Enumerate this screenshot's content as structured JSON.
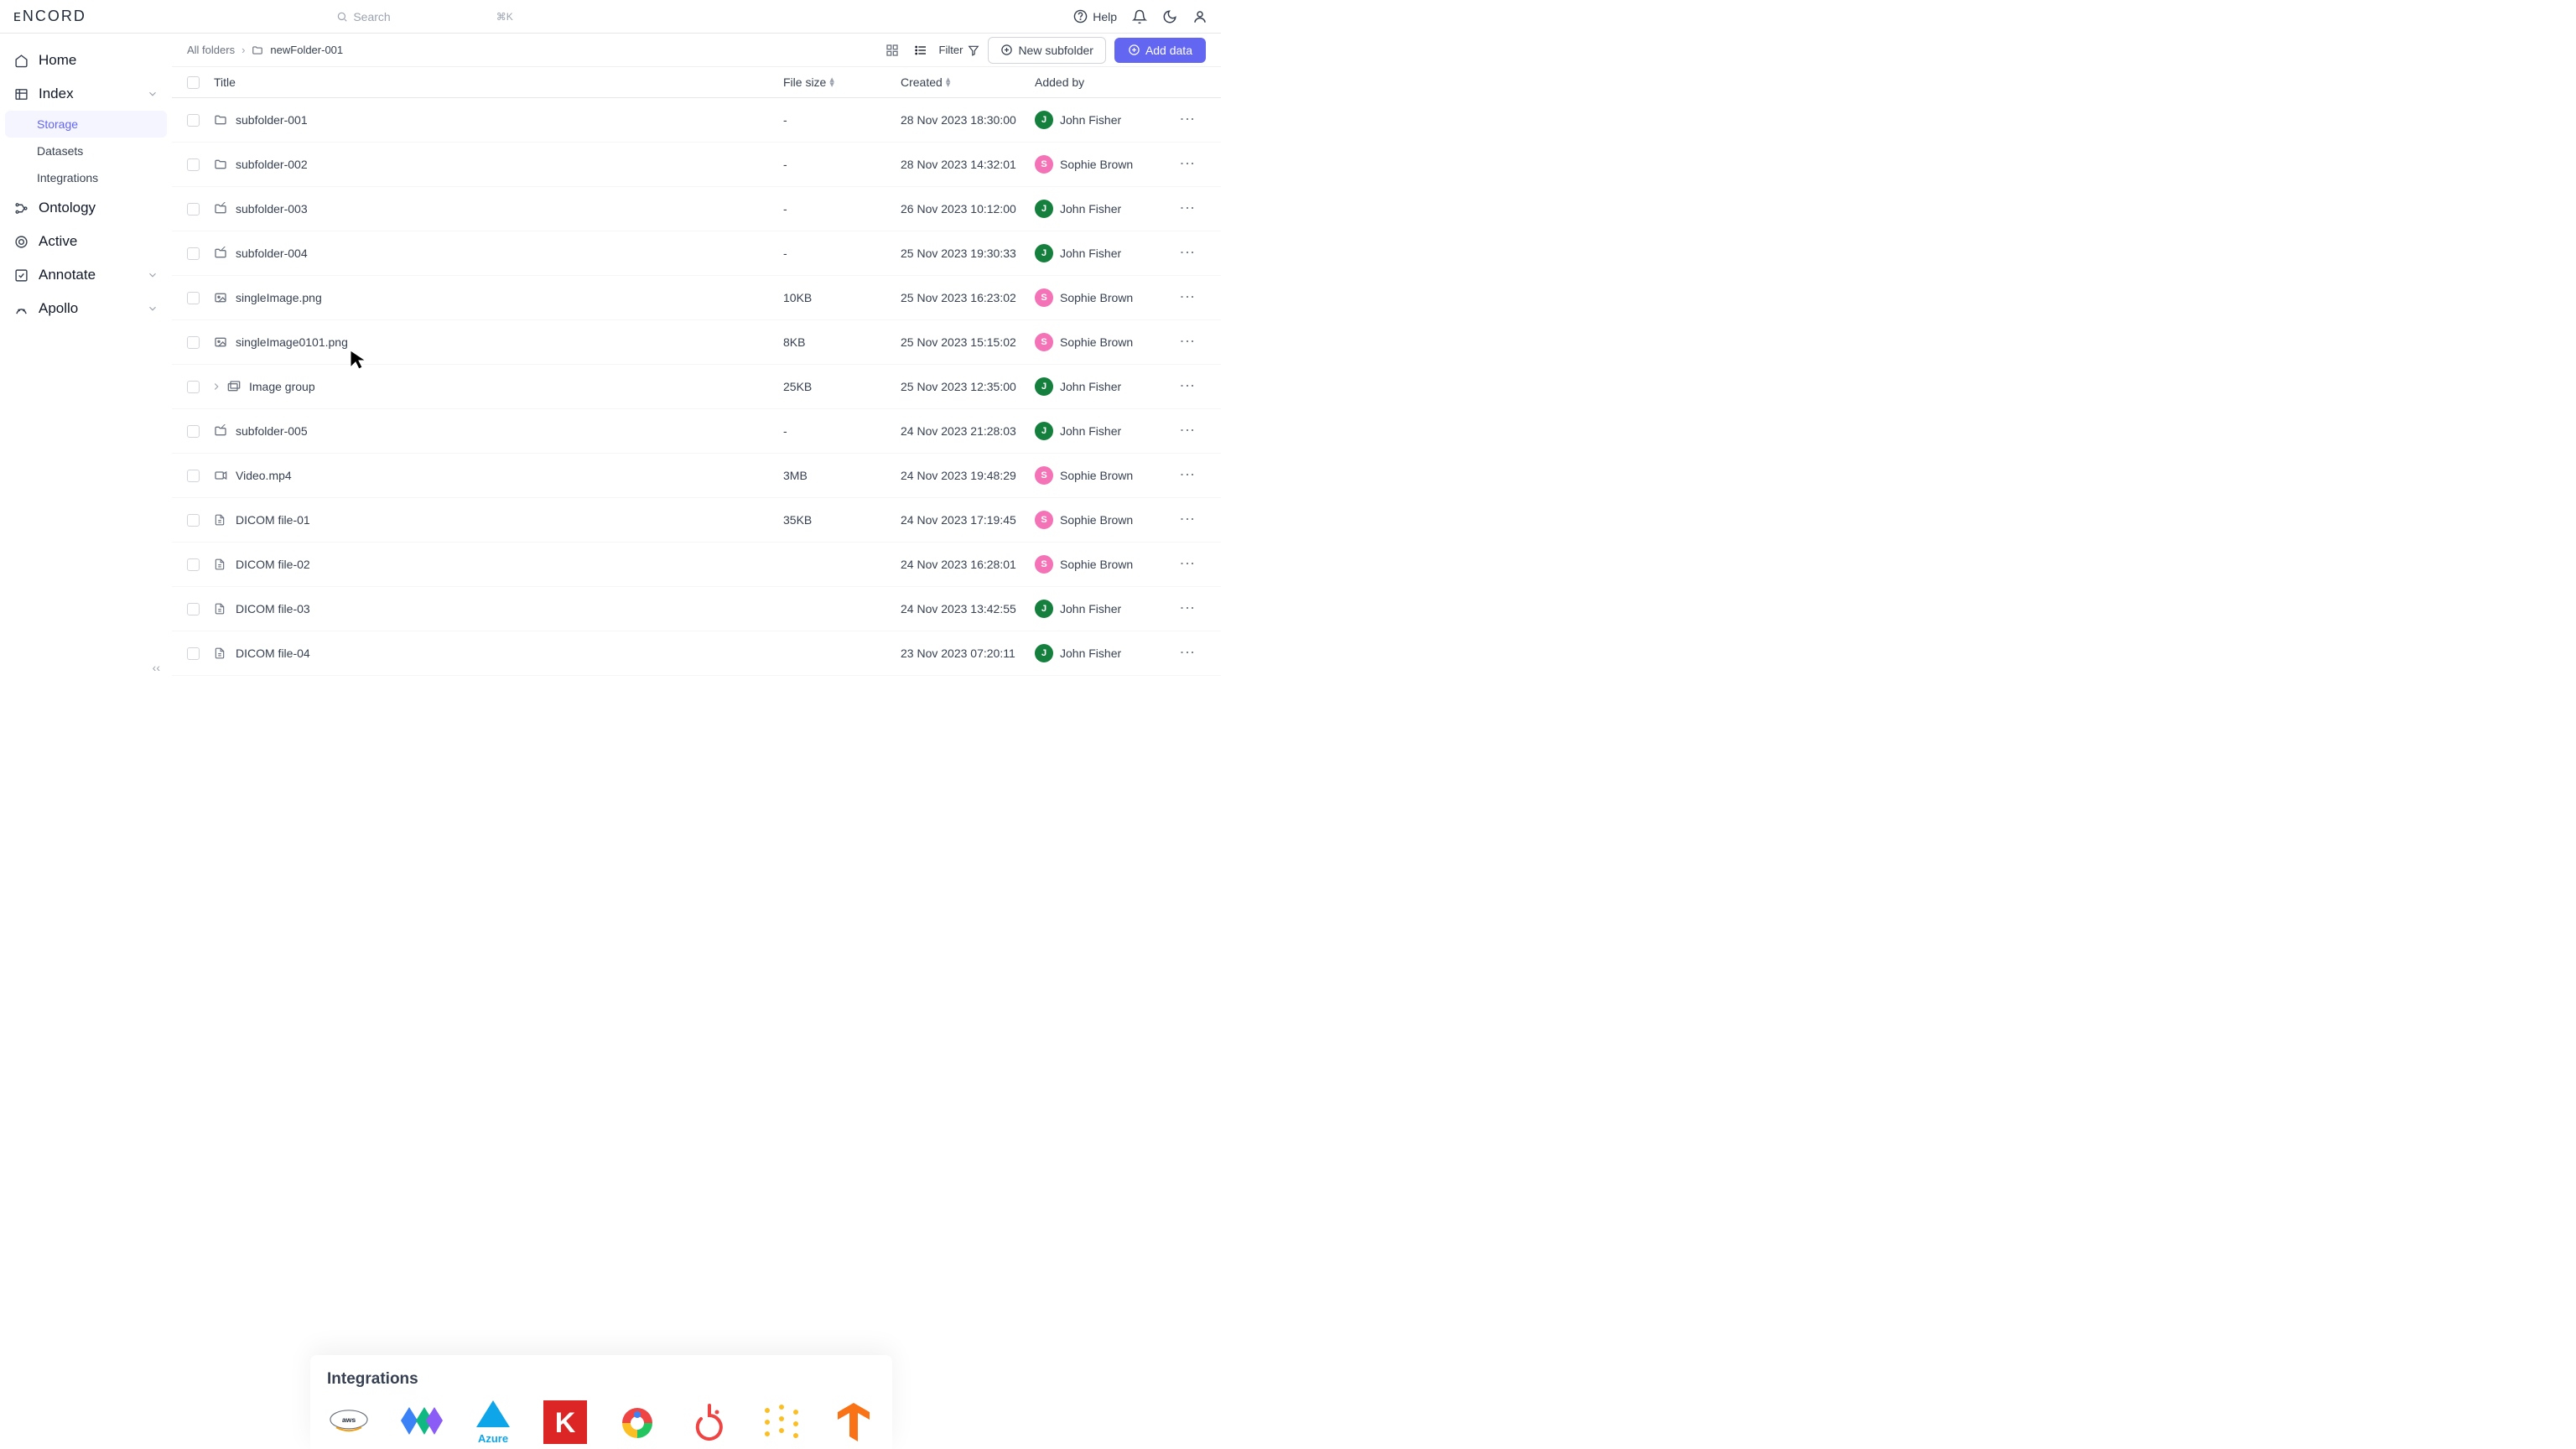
{
  "topbar": {
    "logo": "ENCORD",
    "search_placeholder": "Search",
    "search_shortcut": "⌘K",
    "help_label": "Help"
  },
  "sidebar": {
    "items": [
      {
        "label": "Home",
        "icon": "home"
      },
      {
        "label": "Index",
        "icon": "index",
        "expanded": true,
        "children": [
          {
            "label": "Storage",
            "active": true
          },
          {
            "label": "Datasets"
          },
          {
            "label": "Integrations"
          }
        ]
      },
      {
        "label": "Ontology",
        "icon": "ontology"
      },
      {
        "label": "Active",
        "icon": "active"
      },
      {
        "label": "Annotate",
        "icon": "annotate",
        "expandable": true
      },
      {
        "label": "Apollo",
        "icon": "apollo",
        "expandable": true
      }
    ]
  },
  "breadcrumb": {
    "root": "All folders",
    "current": "newFolder-001"
  },
  "toolbar": {
    "filter_label": "Filter",
    "new_subfolder_label": "New subfolder",
    "add_data_label": "Add data"
  },
  "table": {
    "columns": {
      "title": "Title",
      "size": "File size",
      "created": "Created",
      "added_by": "Added by"
    },
    "rows": [
      {
        "title": "subfolder-001",
        "icon": "folder",
        "size": "-",
        "created": "28 Nov 2023 18:30:00",
        "added_by": "John Fisher",
        "avatar": "J",
        "avatar_color": "green"
      },
      {
        "title": "subfolder-002",
        "icon": "folder",
        "size": "-",
        "created": "28 Nov 2023 14:32:01",
        "added_by": "Sophie Brown",
        "avatar": "S",
        "avatar_color": "pink"
      },
      {
        "title": "subfolder-003",
        "icon": "folder-link",
        "size": "-",
        "created": "26 Nov 2023 10:12:00",
        "added_by": "John Fisher",
        "avatar": "J",
        "avatar_color": "green"
      },
      {
        "title": "subfolder-004",
        "icon": "folder-link",
        "size": "-",
        "created": "25 Nov 2023 19:30:33",
        "added_by": "John Fisher",
        "avatar": "J",
        "avatar_color": "green"
      },
      {
        "title": "singleImage.png",
        "icon": "image",
        "size": "10KB",
        "created": "25 Nov 2023 16:23:02",
        "added_by": "Sophie Brown",
        "avatar": "S",
        "avatar_color": "pink"
      },
      {
        "title": "singleImage0101.png",
        "icon": "image",
        "size": "8KB",
        "created": "25 Nov 2023 15:15:02",
        "added_by": "Sophie Brown",
        "avatar": "S",
        "avatar_color": "pink"
      },
      {
        "title": "Image group",
        "icon": "image-group",
        "size": "25KB",
        "created": "25 Nov 2023 12:35:00",
        "added_by": "John Fisher",
        "avatar": "J",
        "avatar_color": "green",
        "expandable": true
      },
      {
        "title": "subfolder-005",
        "icon": "folder-link",
        "size": "-",
        "created": "24 Nov 2023 21:28:03",
        "added_by": "John Fisher",
        "avatar": "J",
        "avatar_color": "green"
      },
      {
        "title": "Video.mp4",
        "icon": "video",
        "size": "3MB",
        "created": "24 Nov 2023 19:48:29",
        "added_by": "Sophie Brown",
        "avatar": "S",
        "avatar_color": "pink"
      },
      {
        "title": "DICOM file-01",
        "icon": "doc",
        "size": "35KB",
        "created": "24 Nov 2023 17:19:45",
        "added_by": "Sophie Brown",
        "avatar": "S",
        "avatar_color": "pink"
      },
      {
        "title": "DICOM file-02",
        "icon": "doc",
        "size": "",
        "created": "24 Nov 2023 16:28:01",
        "added_by": "Sophie Brown",
        "avatar": "S",
        "avatar_color": "pink"
      },
      {
        "title": "DICOM file-03",
        "icon": "doc",
        "size": "",
        "created": "24 Nov 2023 13:42:55",
        "added_by": "John Fisher",
        "avatar": "J",
        "avatar_color": "green"
      },
      {
        "title": "DICOM file-04",
        "icon": "doc",
        "size": "",
        "created": "23 Nov 2023 07:20:11",
        "added_by": "John Fisher",
        "avatar": "J",
        "avatar_color": "green"
      }
    ]
  },
  "integrations": {
    "title": "Integrations",
    "logos": [
      "aws",
      "jax",
      "azure",
      "keras",
      "gcp",
      "pytorch",
      "wandb",
      "tensorflow"
    ]
  }
}
